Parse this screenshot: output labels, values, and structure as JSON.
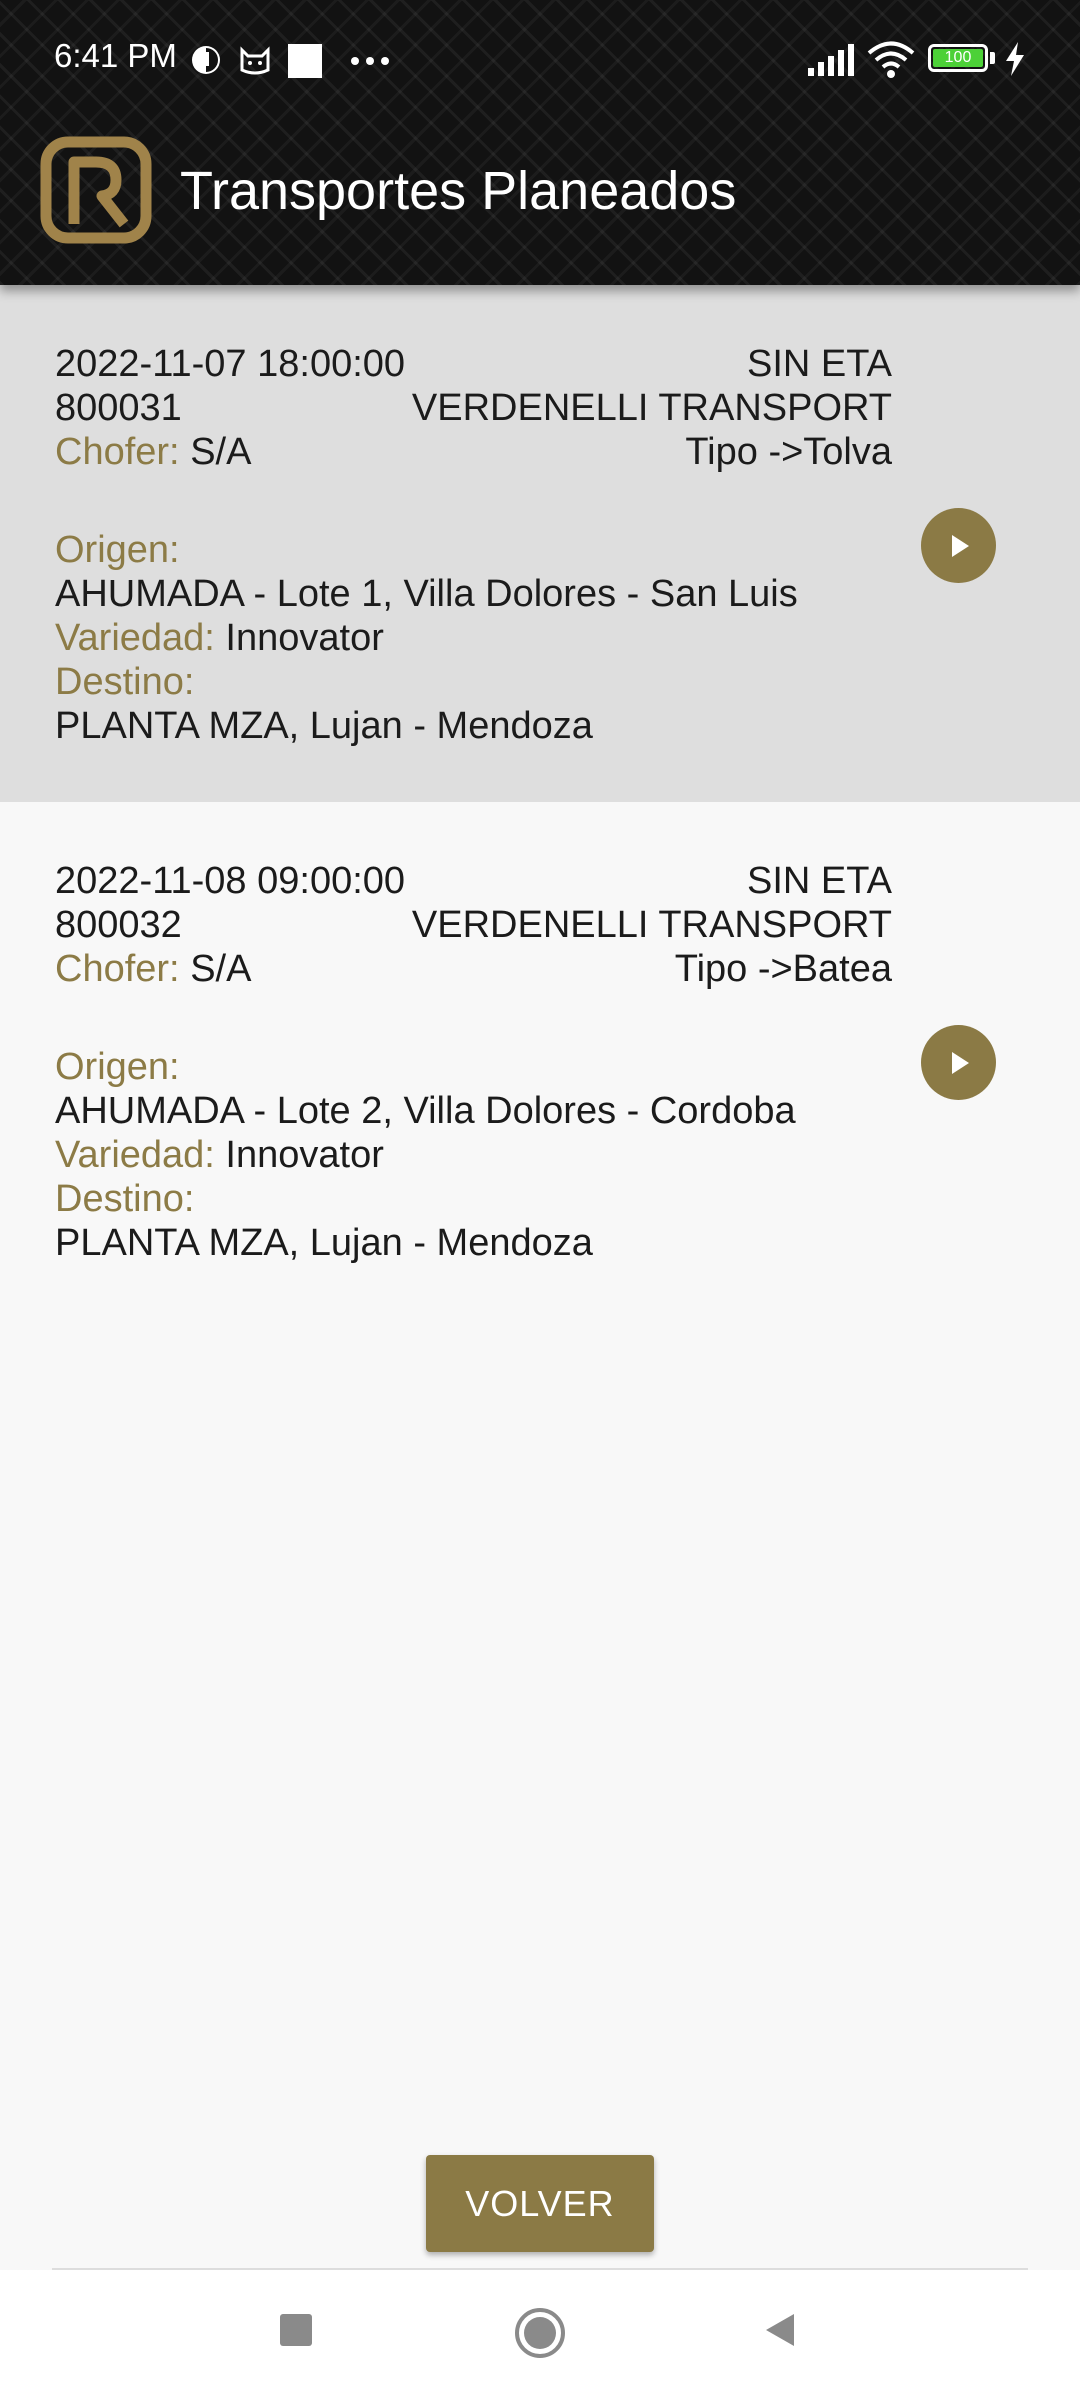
{
  "status_bar": {
    "time": "6:41 PM",
    "battery": "100"
  },
  "header": {
    "title": "Transportes Planeados"
  },
  "transports": [
    {
      "datetime": "2022-11-07 18:00:00",
      "eta": "SIN ETA",
      "id": "800031",
      "company": "VERDENELLI TRANSPORT",
      "driver_label": "Chofer:",
      "driver": "S/A",
      "type": "Tipo ->Tolva",
      "origin_label": "Origen:",
      "origin": "AHUMADA - Lote 1, Villa Dolores - San Luis",
      "variety_label": "Variedad:",
      "variety": "Innovator",
      "destination_label": "Destino:",
      "destination": "PLANTA MZA, Lujan - Mendoza",
      "selected": true
    },
    {
      "datetime": "2022-11-08 09:00:00",
      "eta": "SIN ETA",
      "id": "800032",
      "company": "VERDENELLI TRANSPORT",
      "driver_label": "Chofer:",
      "driver": "S/A",
      "type": "Tipo ->Batea",
      "origin_label": "Origen:",
      "origin": "AHUMADA - Lote 2, Villa Dolores - Cordoba",
      "variety_label": "Variedad:",
      "variety": "Innovator",
      "destination_label": "Destino:",
      "destination": "PLANTA MZA, Lujan - Mendoza",
      "selected": false
    }
  ],
  "footer": {
    "back_label": "VOLVER"
  },
  "colors": {
    "accent": "#8b7a45",
    "label": "#8c7b46",
    "selected_row": "#dedede",
    "background": "#f8f8f8"
  },
  "icons": {
    "status": [
      "data-saver-icon",
      "cat-icon",
      "square-icon",
      "more-icon",
      "signal-icon",
      "wifi-icon",
      "battery-icon",
      "charging-icon"
    ],
    "row_action": "play-icon",
    "nav": [
      "recents-icon",
      "home-icon",
      "back-icon"
    ]
  }
}
